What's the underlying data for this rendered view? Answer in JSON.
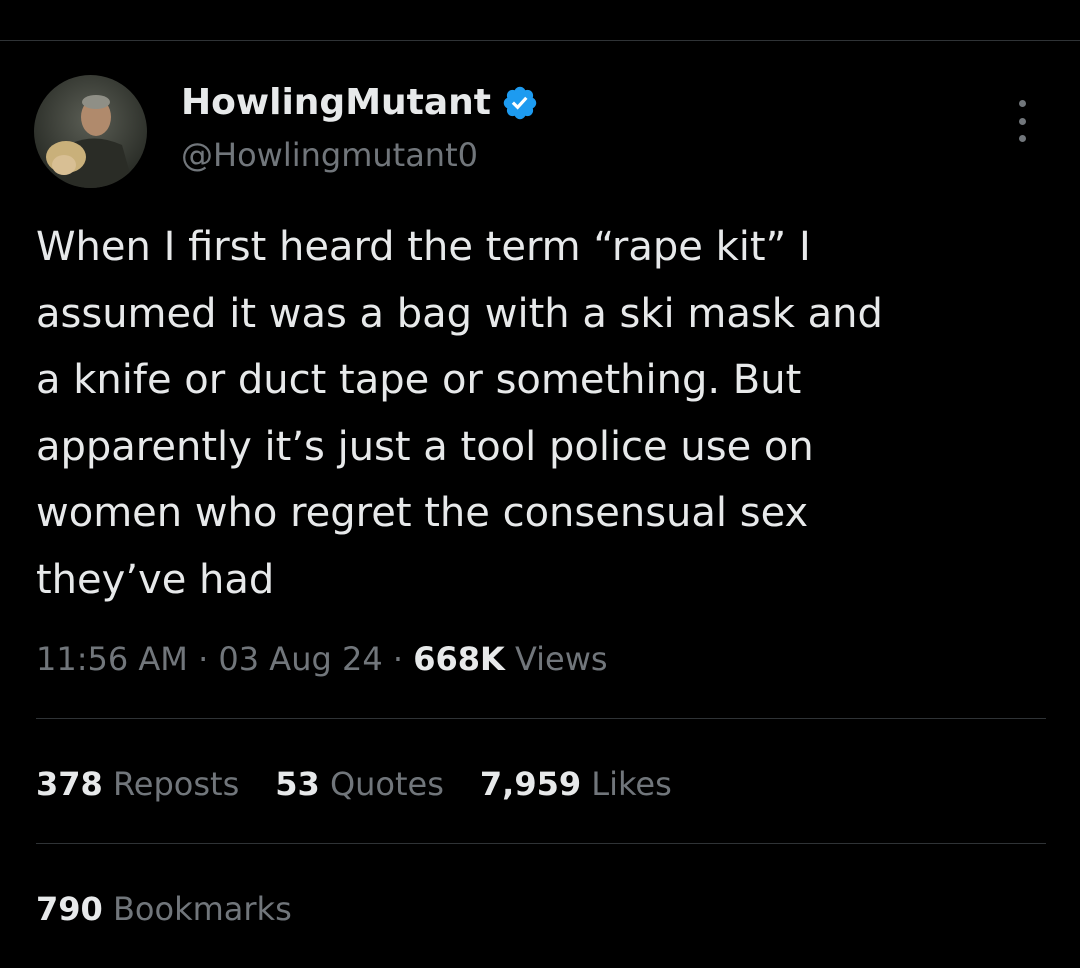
{
  "author": {
    "display_name": "HowlingMutant",
    "handle": "@Howlingmutant0",
    "verified_color": "#1d9bf0"
  },
  "tweet": {
    "lines": [
      "When I first heard the term “rape kit” I",
      "assumed it was a bag with a ski mask and",
      "a knife or duct tape or something.  But",
      "apparently it’s just a tool police use on",
      "women who regret the consensual sex",
      "they’ve had"
    ]
  },
  "meta": {
    "time": "11:56 AM",
    "date": "03 Aug 24",
    "separator": " · ",
    "views_count": "668K",
    "views_label": " Views"
  },
  "stats": {
    "reposts_count": "378",
    "reposts_label": " Reposts",
    "quotes_count": "53",
    "quotes_label": " Quotes",
    "likes_count": "7,959",
    "likes_label": " Likes",
    "bookmarks_count": "790",
    "bookmarks_label": " Bookmarks"
  },
  "icons": {
    "verified": "verified-badge-icon",
    "more": "more-options-icon"
  },
  "colors": {
    "background": "#000000",
    "primary_text": "#e7e9ea",
    "secondary_text": "#71767b",
    "divider": "#2f3336",
    "accent": "#1d9bf0"
  }
}
